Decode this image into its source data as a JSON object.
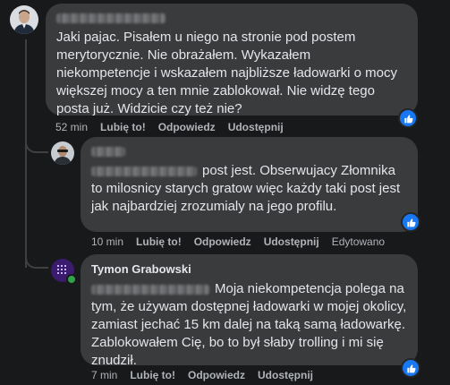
{
  "comments": [
    {
      "author": "",
      "text": "Jaki pajac. Pisałem u niego na stronie pod postem merytorycznie. Nie obrażałem. Wykazałem niekompetencje i wskazałem najbliższe ładowarki o mocy większej mocy a ten mnie zablokował. Nie widzę tego posta już. Widzicie czy też nie?",
      "time": "52 min",
      "like": "Lubię to!",
      "reply": "Odpowiedz",
      "share": "Udostępnij",
      "edited": ""
    },
    {
      "author": "",
      "text": "post jest. Obserwujacy Złomnika to milosnicy starych gratow więc każdy taki post jest jak najbardziej zrozumialy na jego profilu.",
      "time": "10 min",
      "like": "Lubię to!",
      "reply": "Odpowiedz",
      "share": "Udostępnij",
      "edited": "Edytowano"
    },
    {
      "author": "Tymon Grabowski",
      "text": "Moja niekompetencja polega na tym, że używam dostępnej ładowarki w mojej okolicy, zamiast jechać 15 km dalej na taką samą ładowarkę. Zablokowałem Cię, bo to był słaby trolling i mi się znudził.",
      "time": "7 min",
      "like": "Lubię to!",
      "reply": "Odpowiedz",
      "share": "Udostępnij",
      "edited": ""
    }
  ],
  "colors": {
    "background": "#18191a",
    "bubble": "#3a3b3c",
    "meta": "#b0b3b8",
    "like_blue": "#1877f2"
  },
  "icons": [
    "avatar",
    "like-thumb-icon"
  ]
}
